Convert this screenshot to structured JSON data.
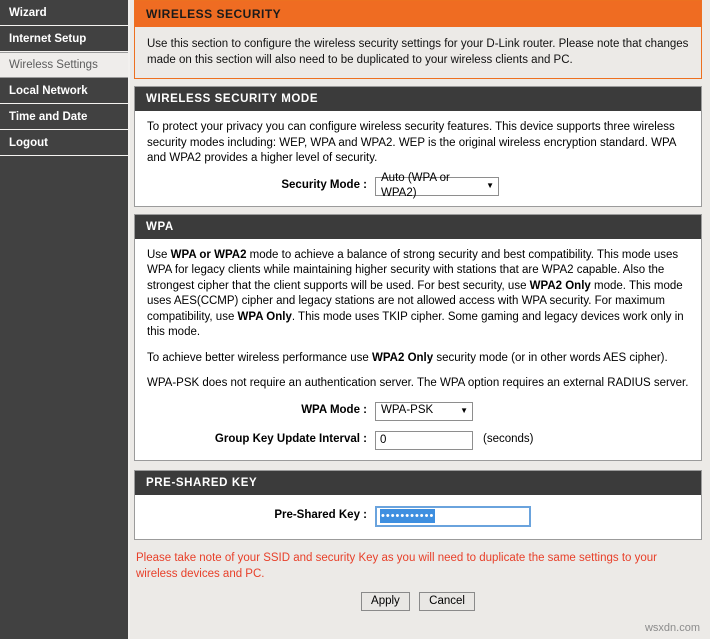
{
  "sidebar": {
    "items": [
      {
        "label": "Wizard",
        "active": false
      },
      {
        "label": "Internet Setup",
        "active": false
      },
      {
        "label": "Wireless Settings",
        "active": true
      },
      {
        "label": "Local Network",
        "active": false
      },
      {
        "label": "Time and Date",
        "active": false
      },
      {
        "label": "Logout",
        "active": false
      }
    ]
  },
  "notice": {
    "title": "WIRELESS SECURITY",
    "body": "Use this section to configure the wireless security settings for your D-Link router. Please note that changes made on this section will also need to be duplicated to your wireless clients and PC."
  },
  "security_mode_section": {
    "title": "WIRELESS SECURITY MODE",
    "description": "To protect your privacy you can configure wireless security features. This device supports three wireless security modes including: WEP, WPA and WPA2. WEP is the original wireless encryption standard. WPA and WPA2 provides a higher level of security.",
    "field_label": "Security Mode :",
    "field_value": "Auto (WPA or WPA2)",
    "caret": "▼"
  },
  "wpa_section": {
    "title": "WPA",
    "paragraph1": {
      "p1": "Use ",
      "b1": "WPA or WPA2",
      "p2": " mode to achieve a balance of strong security and best compatibility. This mode uses WPA for legacy clients while maintaining higher security with stations that are WPA2 capable. Also the strongest cipher that the client supports will be used. For best security, use ",
      "b2": "WPA2 Only",
      "p3": " mode. This mode uses AES(CCMP) cipher and legacy stations are not allowed access with WPA security. For maximum compatibility, use ",
      "b3": "WPA Only",
      "p4": ". This mode uses TKIP cipher. Some gaming and legacy devices work only in this mode."
    },
    "paragraph2": {
      "p1": "To achieve better wireless performance use ",
      "b1": "WPA2 Only",
      "p2": " security mode (or in other words AES cipher)."
    },
    "paragraph3": "WPA-PSK does not require an authentication server. The WPA option requires an external RADIUS server.",
    "wpa_mode_label": "WPA Mode :",
    "wpa_mode_value": "WPA-PSK",
    "group_key_label": "Group Key Update Interval :",
    "group_key_value": "0",
    "group_key_suffix": "(seconds)",
    "caret": "▼"
  },
  "psk_section": {
    "title": "PRE-SHARED KEY",
    "field_label": "Pre-Shared Key :",
    "field_value": "•••••••••••",
    "masked": true
  },
  "warning": "Please take note of your SSID and security Key as you will need to duplicate the same settings to your wireless devices and PC.",
  "buttons": {
    "apply": "Apply",
    "cancel": "Cancel"
  },
  "watermark": "wsxdn.com",
  "colors": {
    "accent_orange": "#ef6c22",
    "section_header": "#3b3b3b",
    "sidebar": "#414141",
    "warning_red": "#e8402a",
    "focus_blue": "#6aa3dd",
    "selection_blue": "#3e8fe0"
  }
}
